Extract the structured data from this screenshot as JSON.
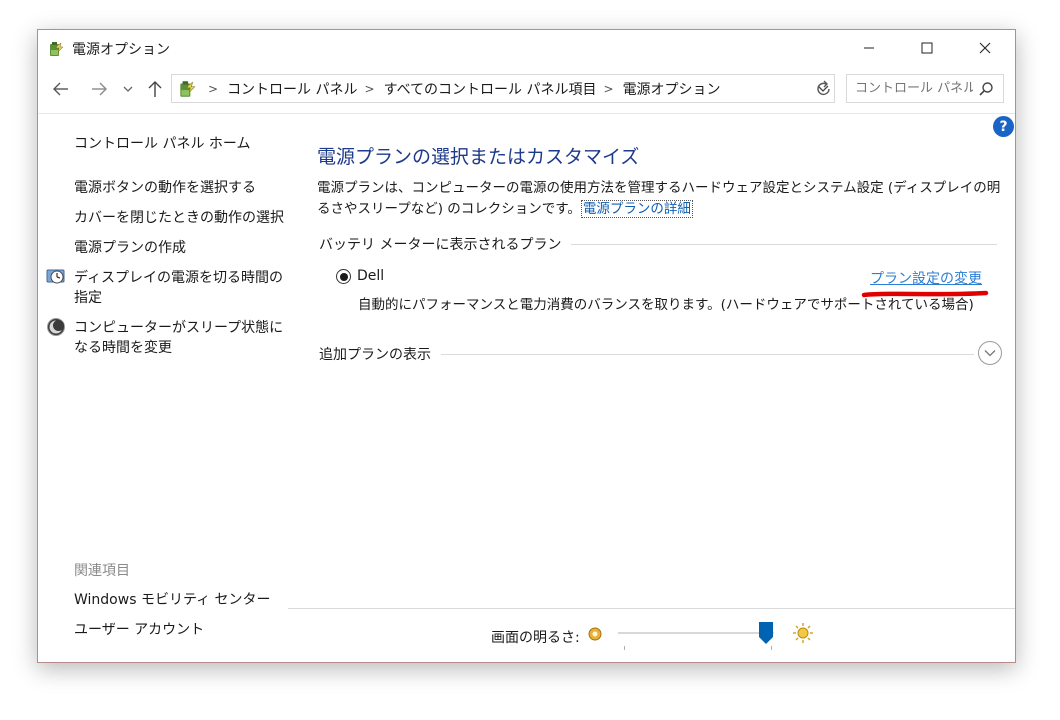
{
  "window": {
    "title": "電源オプション",
    "controls": {
      "minimize": "minimize",
      "maximize": "maximize",
      "close": "close"
    }
  },
  "address_bar": {
    "breadcrumbs": [
      "コントロール パネル",
      "すべてのコントロール パネル項目",
      "電源オプション"
    ],
    "search_placeholder": "コントロール パネル..."
  },
  "sidebar": {
    "home_link": "コントロール パネル ホーム",
    "links": [
      {
        "label": "電源ボタンの動作を選択する",
        "icon": "none"
      },
      {
        "label": "カバーを閉じたときの動作の選択",
        "icon": "none"
      },
      {
        "label": "電源プランの作成",
        "icon": "none"
      },
      {
        "label": "ディスプレイの電源を切る時間の指定",
        "icon": "display-clock-icon"
      },
      {
        "label": "コンピューターがスリープ状態になる時間を変更",
        "icon": "moon-sleep-icon"
      }
    ],
    "related_heading": "関連項目",
    "related_links": [
      "Windows モビリティ センター",
      "ユーザー アカウント"
    ]
  },
  "main": {
    "help": "?",
    "title": "電源プランの選択またはカスタマイズ",
    "description": "電源プランは、コンピューターの電源の使用方法を管理するハードウェア設定とシステム設定 (ディスプレイの明るさやスリープなど) のコレクションです。",
    "description_link": "電源プランの詳細",
    "battery_section_label": "バッテリ メーターに表示されるプラン",
    "plan": {
      "name": "Dell",
      "selected": true,
      "change_link": "プラン設定の変更",
      "description": "自動的にパフォーマンスと電力消費のバランスを取ります。(ハードウェアでサポートされている場合)"
    },
    "additional_plans_label": "追加プランの表示"
  },
  "bottom": {
    "brightness_label": "画面の明るさ:",
    "brightness_value": 0.95
  },
  "colors": {
    "title_blue": "#1e3a8a",
    "link_blue": "#2d7dd2",
    "annotation_red": "#e00000",
    "slider_thumb": "#0063b1"
  }
}
